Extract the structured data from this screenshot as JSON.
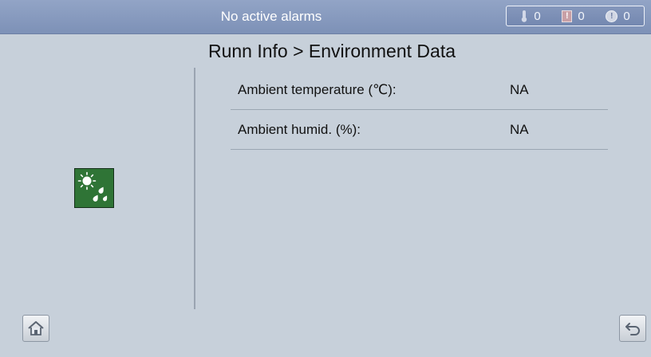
{
  "header": {
    "alarm_status": "No active alarms",
    "counters": {
      "minor": "0",
      "major": "0",
      "critical": "0"
    }
  },
  "page": {
    "title": "Runn Info > Environment Data"
  },
  "rows": [
    {
      "label": "Ambient temperature (℃):",
      "value": "NA"
    },
    {
      "label": "Ambient humid. (%):",
      "value": "NA"
    }
  ],
  "icons": {
    "side": "environment-icon",
    "home": "home-icon",
    "back": "back-icon"
  },
  "colors": {
    "header_bg": "#8a9dc1",
    "body_bg": "#c7d0da",
    "side_icon_bg": "#2f7436"
  }
}
